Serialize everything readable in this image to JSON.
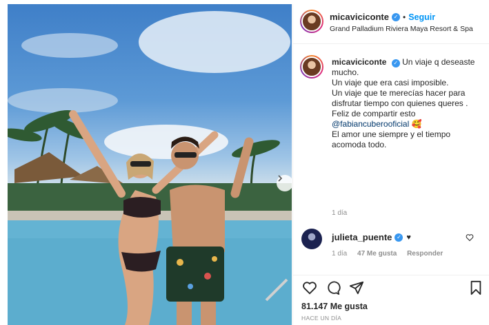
{
  "post": {
    "author": "micaviciconte",
    "follow_label": "Seguir",
    "separator": "•",
    "location": "Grand Palladium Riviera Maya Resort & Spa",
    "caption_prefix": "Un viaje q deseaste mucho.",
    "caption_lines": [
      "Un viaje que era casi imposible.",
      "Un viaje que te merecías hacer para disfrutar tiempo con quienes queres .",
      "Feliz de compartir esto"
    ],
    "mention": "@fabiancuberooficial",
    "emoji": "🥰",
    "caption_end": "El amor une siempre y el tiempo acomoda todo.",
    "caption_time": "1 día",
    "likes": "81.147 Me gusta",
    "posted_ago": "HACE UN DÍA"
  },
  "comment": {
    "user": "julieta_puente",
    "text": "♥",
    "time": "1 día",
    "likes": "47 Me gusta",
    "reply_label": "Responder"
  },
  "icons": {
    "verified": "verified-badge-icon",
    "heart": "heart-icon",
    "comment": "comment-icon",
    "share": "share-icon",
    "save": "bookmark-icon",
    "next": "chevron-right-icon"
  },
  "colors": {
    "accent": "#0095f6",
    "verified": "#3897f0",
    "muted": "#8e8e8e",
    "mention": "#00376b"
  }
}
